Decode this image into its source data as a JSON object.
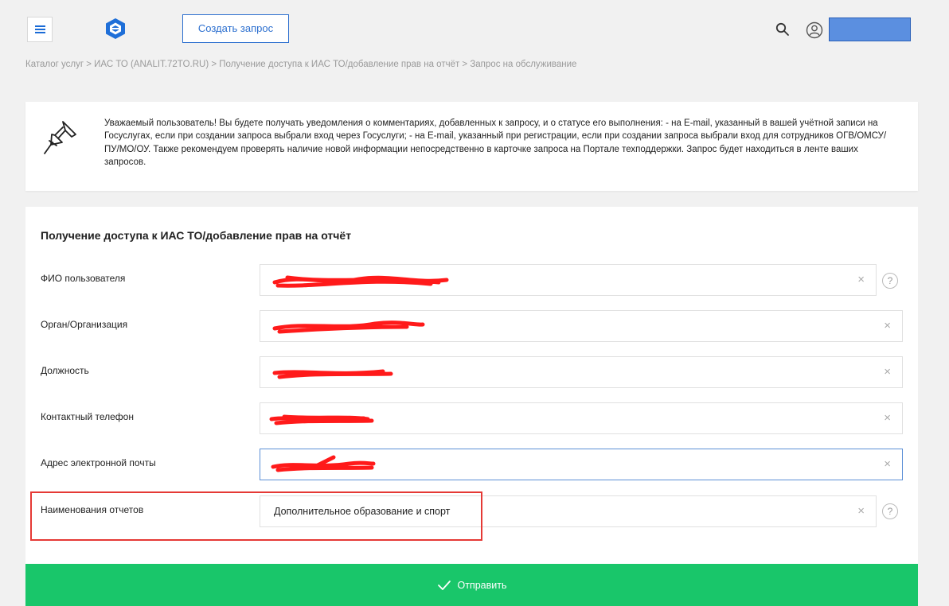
{
  "header": {
    "create_label": "Создать запрос"
  },
  "breadcrumb": "Каталог услуг > ИАС ТО (ANALIT.72TO.RU) > Получение доступа к ИАС ТО/добавление прав на отчёт > Запрос на обслуживание",
  "notice": {
    "text": "Уважаемый пользователь! Вы будете получать уведомления о комментариях, добавленных к запросу, и о статусе его выполнения: - на E-mail, указанный в вашей учётной записи на Госуслугах, если при создании запроса выбрали вход через Госуслуги; - на E-mail, указанный при регистрации, если при создании запроса выбрали вход для сотрудников ОГВ/ОМСУ/ПУ/МО/ОУ. Также рекомендуем проверять наличие новой информации непосредственно в карточке запроса на Портале техподдержки. Запрос будет находиться в ленте ваших запросов."
  },
  "form": {
    "title": "Получение доступа к ИАС ТО/добавление прав на отчёт",
    "fields": [
      {
        "label": "ФИО пользователя",
        "value": ""
      },
      {
        "label": "Орган/Организация",
        "value": ""
      },
      {
        "label": "Должность",
        "value": ""
      },
      {
        "label": "Контактный телефон",
        "value": ""
      },
      {
        "label": "Адрес электронной почты",
        "value": ""
      },
      {
        "label": "Наименования отчетов",
        "value": "Дополнительное образование и спорт"
      }
    ],
    "clear_glyph": "×",
    "help_glyph": "?",
    "submit_label": "Отправить"
  },
  "colors": {
    "accent": "#2c6fcf",
    "submit": "#19c66a",
    "highlight": "#e53935",
    "redaction": "#ff1a1a"
  }
}
